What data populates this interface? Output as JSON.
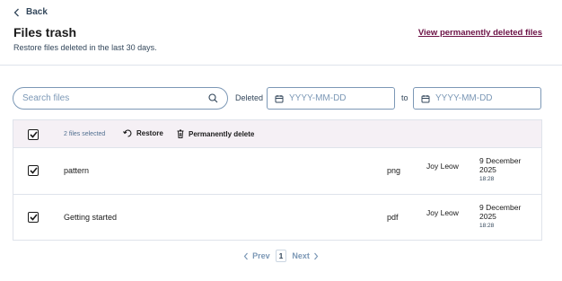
{
  "header": {
    "back_label": "Back",
    "title": "Files trash",
    "subtitle": "Restore files deleted in the last 30 days.",
    "permanent_link": "View permanently deleted files"
  },
  "filters": {
    "search_placeholder": "Search files",
    "deleted_label": "Deleted",
    "date_from_placeholder": "YYYY-MM-DD",
    "to_label": "to",
    "date_to_placeholder": "YYYY-MM-DD"
  },
  "table": {
    "selected_count": "2 files selected",
    "restore_label": "Restore",
    "delete_label": "Permanently delete",
    "rows": [
      {
        "name": "pattern",
        "type": "png",
        "owner": "Joy Leow",
        "date": "9 December 2025",
        "time": "18:28",
        "checked": true
      },
      {
        "name": "Getting started",
        "type": "pdf",
        "owner": "Joy Leow",
        "date": "9 December 2025",
        "time": "18:28",
        "checked": true
      }
    ]
  },
  "pagination": {
    "prev_label": "Prev",
    "current_page": "1",
    "next_label": "Next"
  },
  "colors": {
    "accent_link": "#6b1044",
    "header_bg": "#f5f0f5",
    "border": "#dfe3eb"
  }
}
